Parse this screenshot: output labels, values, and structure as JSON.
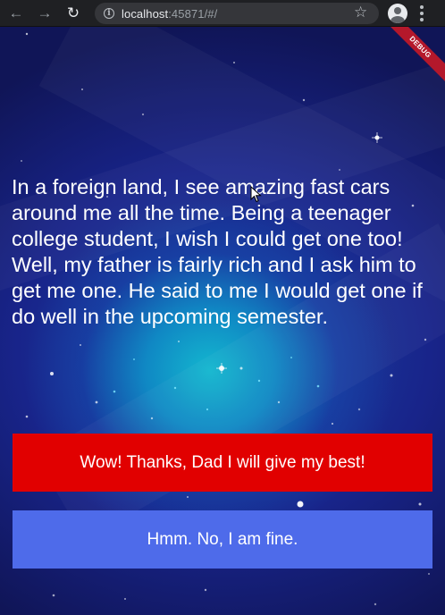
{
  "browser": {
    "url_host": "localhost",
    "url_rest": ":45871/#/",
    "icons": {
      "back": "arrow-left-icon",
      "forward": "arrow-right-icon",
      "reload": "reload-icon",
      "site_info": "info-icon",
      "bookmark": "star-icon",
      "profile": "profile-icon",
      "menu": "more-vert-icon"
    }
  },
  "app": {
    "debug_banner": "DEBUG",
    "story_text": "In a foreign land, I see amazing fast cars around me all the time. Being a teenager college student, I wish I could get one too! Well, my father is fairly rich and I ask him to get me one. He said to me I would get one if do well in the upcoming semester.",
    "choice_1": "Wow! Thanks, Dad I will give my best!",
    "choice_2": "Hmm. No, I am fine."
  },
  "colors": {
    "choice_1_bg": "#e10000",
    "choice_2_bg": "#4e6bea",
    "story_text": "#ffffff",
    "debug_banner": "#b4182b"
  }
}
